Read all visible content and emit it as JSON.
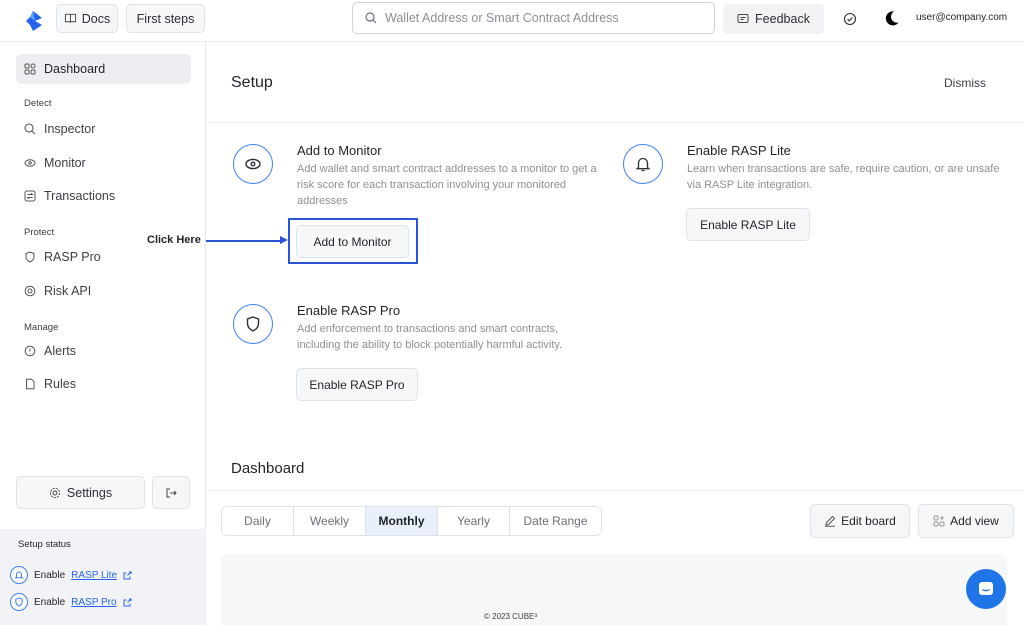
{
  "topbar": {
    "docs_label": "Docs",
    "first_steps_label": "First steps",
    "search_placeholder": "Wallet Address or Smart Contract Address",
    "feedback_label": "Feedback",
    "user_email": "user@company.com"
  },
  "sidebar": {
    "dashboard": "Dashboard",
    "sections": {
      "detect": "Detect",
      "protect": "Protect",
      "manage": "Manage"
    },
    "detect_items": [
      "Inspector",
      "Monitor",
      "Transactions"
    ],
    "protect_items": [
      "RASP Pro",
      "Risk API"
    ],
    "manage_items": [
      "Alerts",
      "Rules"
    ],
    "settings_label": "Settings",
    "setup_status": {
      "title": "Setup status",
      "items": [
        {
          "prefix": "Enable",
          "link": "RASP Lite"
        },
        {
          "prefix": "Enable",
          "link": "RASP Pro"
        }
      ]
    }
  },
  "setup": {
    "title": "Setup",
    "dismiss": "Dismiss",
    "annotation": "Click Here",
    "cards": {
      "monitor": {
        "title": "Add to Monitor",
        "desc": "Add wallet and smart contract addresses to a monitor to get a risk score for each transaction involving your monitored addresses",
        "button": "Add to Monitor"
      },
      "rasp_lite": {
        "title": "Enable RASP Lite",
        "desc": "Learn when transactions are safe, require caution, or are unsafe via RASP Lite integration.",
        "button": "Enable RASP Lite"
      },
      "rasp_pro": {
        "title": "Enable RASP Pro",
        "desc": "Add enforcement to transactions and smart contracts, including the ability to block potentially harmful activity.",
        "button": "Enable RASP Pro"
      }
    }
  },
  "dashboard": {
    "title": "Dashboard",
    "ranges": [
      "Daily",
      "Weekly",
      "Monthly",
      "Yearly",
      "Date Range"
    ],
    "active_range": "Monthly",
    "edit_board": "Edit board",
    "add_view": "Add view"
  },
  "footer": "© 2023 CUBE³",
  "colors": {
    "accent": "#3b82f6",
    "annotation": "#2b53d8",
    "chat": "#1f74e8"
  }
}
